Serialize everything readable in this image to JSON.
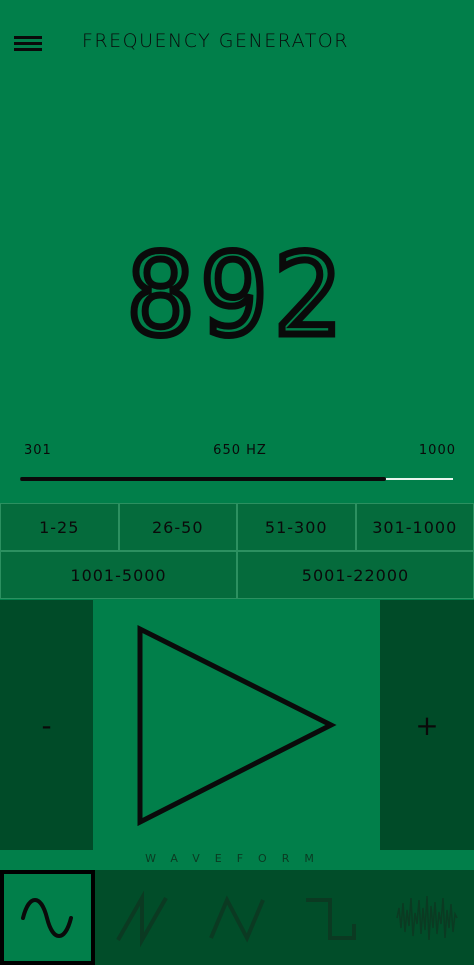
{
  "header": {
    "menu_icon": "hamburger-menu-icon",
    "title": "FREQUENCY GENERATOR"
  },
  "frequency": {
    "value": "892"
  },
  "slider": {
    "min_label": "301",
    "mid_label": "650 HZ",
    "max_label": "1000",
    "min": 301,
    "max": 1000,
    "value": 892
  },
  "ranges": {
    "row1": [
      "1-25",
      "26-50",
      "51-300",
      "301-1000"
    ],
    "row2": [
      "1001-5000",
      "5001-22000"
    ]
  },
  "controls": {
    "decrement": "-",
    "increment": "+",
    "play_icon": "play-triangle-icon"
  },
  "waveform": {
    "label": "WAVEFORM",
    "options": [
      "sine",
      "sawtooth",
      "triangle",
      "square",
      "noise"
    ],
    "selected": "sine"
  },
  "colors": {
    "background": "#017f4a",
    "dark_panel": "#004b28",
    "text": "#0a0a0a"
  }
}
